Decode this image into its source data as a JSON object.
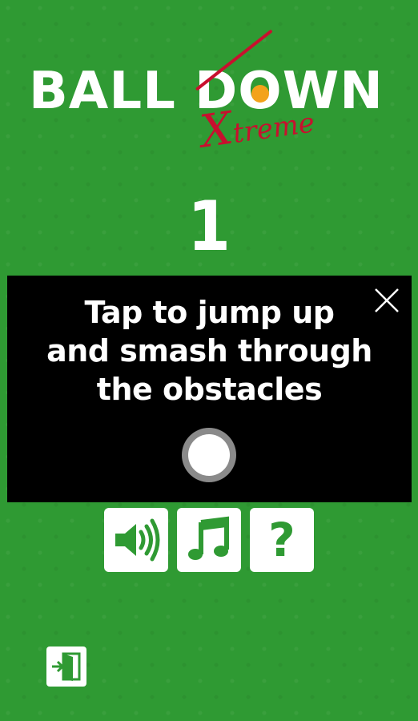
{
  "game": {
    "title_part1": "BALL D",
    "title_o": "O",
    "title_part2": "WN",
    "subtitle_big": "X",
    "subtitle_small": "treme",
    "score": "1"
  },
  "tutorial": {
    "line1": "Tap to jump up",
    "line2": "and smash through",
    "line3": "the obstacles"
  },
  "buttons": {
    "sound": "speaker-icon",
    "music": "music-note-icon",
    "help": "?",
    "exit": "exit-door-icon",
    "close": "close-icon"
  },
  "colors": {
    "background": "#2f9a33",
    "panel": "#000000",
    "accent_red": "#c8102e",
    "ball_orange": "#f3a21a",
    "button_icon": "#2f9a33"
  }
}
